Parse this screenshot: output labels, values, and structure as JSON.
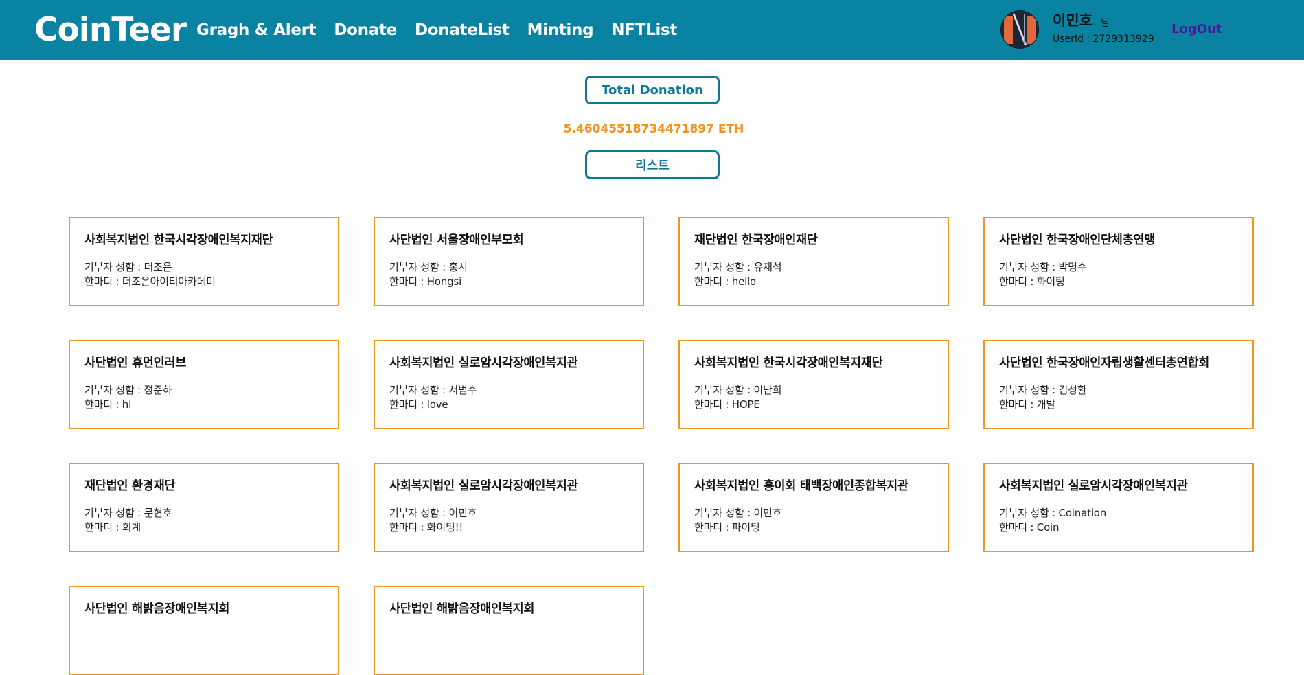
{
  "header": {
    "logo": "CoinTeer",
    "nav": [
      "Gragh & Alert",
      "Donate",
      "DonateList",
      "Minting",
      "NFTList"
    ],
    "user_name": "이민호",
    "user_suffix": "님",
    "user_id": "UserId : 2729313929",
    "logout": "LogOut"
  },
  "summary": {
    "total_button": "Total Donation",
    "total_amount": "5.46045518734471897 ETH",
    "list_button": "리스트"
  },
  "donations": [
    {
      "org": "사회복지법인 한국시각장애인복지재단",
      "donor": "기부자 성함 : 더조은",
      "message": "한마디 : 더조은아이티아카데미"
    },
    {
      "org": "사단법인 서울장애인부모회",
      "donor": "기부자 성함 : 홍시",
      "message": "한마디 : Hongsi"
    },
    {
      "org": "재단법인 한국장애인재단",
      "donor": "기부자 성함 : 유재석",
      "message": "한마디 : hello"
    },
    {
      "org": "사단법인 한국장애인단체총연맹",
      "donor": "기부자 성함 : 박명수",
      "message": "한마디 : 화이팅"
    },
    {
      "org": "사단법인 휴먼인러브",
      "donor": "기부자 성함 : 정준하",
      "message": "한마디 : hi"
    },
    {
      "org": "사회복지법인 실로암시각장애인복지관",
      "donor": "기부자 성함 : 서범수",
      "message": "한마디 : love"
    },
    {
      "org": "사회복지법인 한국시각장애인복지재단",
      "donor": "기부자 성함 : 이난희",
      "message": "한마디 : HOPE"
    },
    {
      "org": "사단법인 한국장애인자립생활센터총연합회",
      "donor": "기부자 성함 : 김성환",
      "message": "한마디 : 개발"
    },
    {
      "org": "재단법인 환경재단",
      "donor": "기부자 성함 : 문현호",
      "message": "한마디 : 회계"
    },
    {
      "org": "사회복지법인 실로암시각장애인복지관",
      "donor": "기부자 성함 : 이민호",
      "message": "한마디 : 화이팅!!"
    },
    {
      "org": "사회복지법인 홍이회 태백장애인종합복지관",
      "donor": "기부자 성함 : 이민호",
      "message": "한마디 : 파이팅"
    },
    {
      "org": "사회복지법인 실로암시각장애인복지관",
      "donor": "기부자 성함 : Coination",
      "message": "한마디 : Coin"
    },
    {
      "org": "사단법인 해밝음장애인복지회",
      "donor": "",
      "message": ""
    },
    {
      "org": "사단법인 해밝음장애인복지회",
      "donor": "",
      "message": ""
    }
  ],
  "colors": {
    "header_bg": "#0a82a1",
    "button_border": "#0f7893",
    "amount": "#f2911e",
    "card_border": "#f0951f",
    "logout": "#4b1a9a"
  },
  "icons": {
    "avatar": "user-avatar-image"
  }
}
